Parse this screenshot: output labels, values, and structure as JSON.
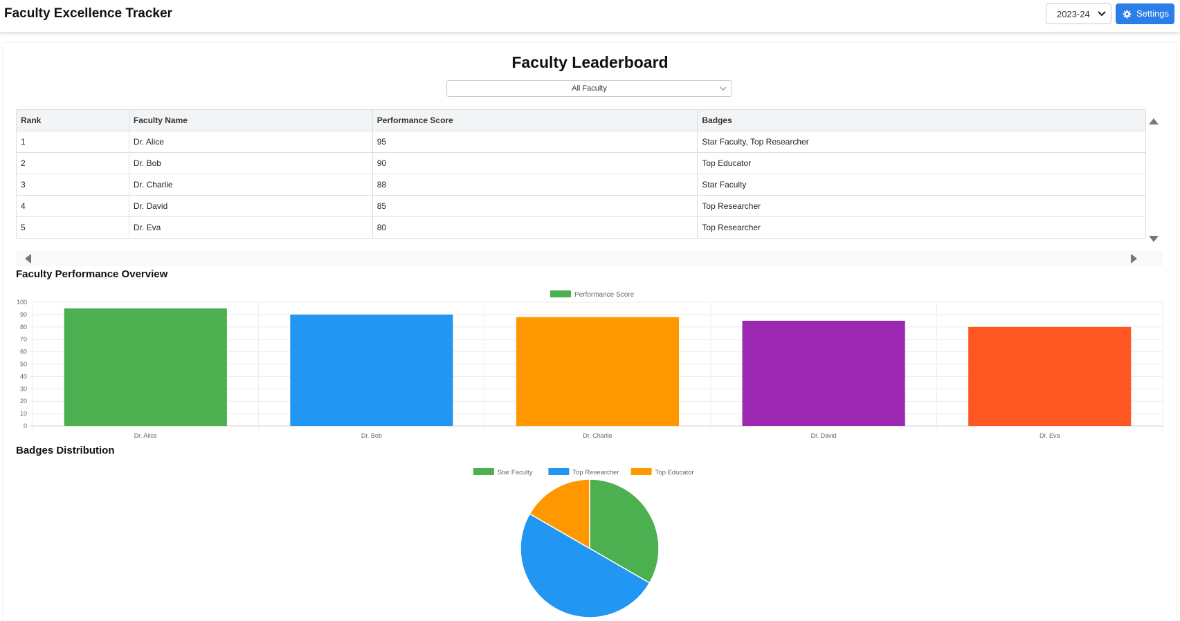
{
  "header": {
    "title": "Faculty Excellence Tracker",
    "year": "2023-24",
    "settings_label": "Settings"
  },
  "leaderboard": {
    "title": "Faculty Leaderboard",
    "filter": "All Faculty",
    "columns": [
      "Rank",
      "Faculty Name",
      "Performance Score",
      "Badges"
    ],
    "rows": [
      [
        "1",
        "Dr. Alice",
        "95",
        "Star Faculty, Top Researcher"
      ],
      [
        "2",
        "Dr. Bob",
        "90",
        "Top Educator"
      ],
      [
        "3",
        "Dr. Charlie",
        "88",
        "Star Faculty"
      ],
      [
        "4",
        "Dr. David",
        "85",
        "Top Researcher"
      ],
      [
        "5",
        "Dr. Eva",
        "80",
        "Top Researcher"
      ]
    ]
  },
  "sections": {
    "performance_title": "Faculty Performance Overview",
    "badges_title": "Badges Distribution"
  },
  "chart_data": [
    {
      "type": "bar",
      "categories": [
        "Dr. Alice",
        "Dr. Bob",
        "Dr. Charlie",
        "Dr. David",
        "Dr. Eva"
      ],
      "series": [
        {
          "name": "Performance Score",
          "values": [
            95,
            90,
            88,
            85,
            80
          ]
        }
      ],
      "colors": [
        "#4caf50",
        "#2196f3",
        "#ff9800",
        "#9c27b0",
        "#ff5722"
      ],
      "ylim": [
        0,
        100
      ],
      "yticks": [
        0,
        10,
        20,
        30,
        40,
        50,
        60,
        70,
        80,
        90,
        100
      ],
      "grid": true,
      "legend": "top-center",
      "legend_color": "#4caf50"
    },
    {
      "type": "pie",
      "categories": [
        "Star Faculty",
        "Top Researcher",
        "Top Educator"
      ],
      "values": [
        2,
        3,
        1
      ],
      "colors": [
        "#4caf50",
        "#2196f3",
        "#ff9800"
      ],
      "legend": "top-center"
    }
  ]
}
